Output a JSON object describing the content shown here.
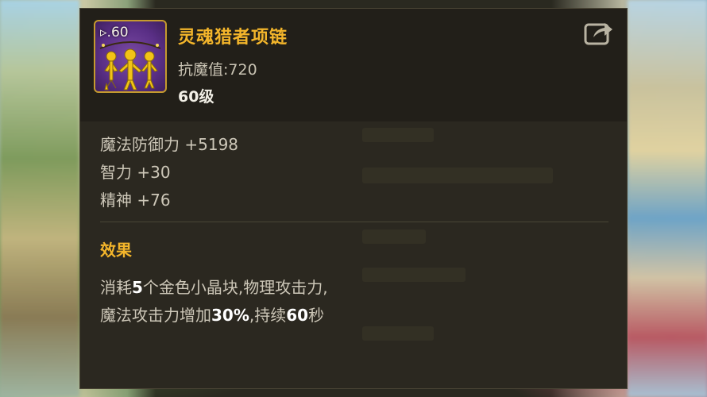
{
  "item": {
    "level_badge": "60",
    "name": "灵魂猎者项链",
    "resist_label": "抗魔值:720",
    "level_requirement": "60级",
    "icon": "necklace-figures-icon",
    "rarity_color": "#f3b52b"
  },
  "share": {
    "icon": "share-icon"
  },
  "stats": [
    "魔法防御力 +5198",
    "智力 +30",
    "精神 +76"
  ],
  "effect": {
    "title": "效果",
    "desc_parts": {
      "p1": "消耗",
      "n1": "5",
      "p2": "个金色小晶块,物理攻击力,",
      "p3": "魔法攻击力增加",
      "n2": "30%",
      "p4": ",持续",
      "n3": "60",
      "p5": "秒"
    }
  }
}
